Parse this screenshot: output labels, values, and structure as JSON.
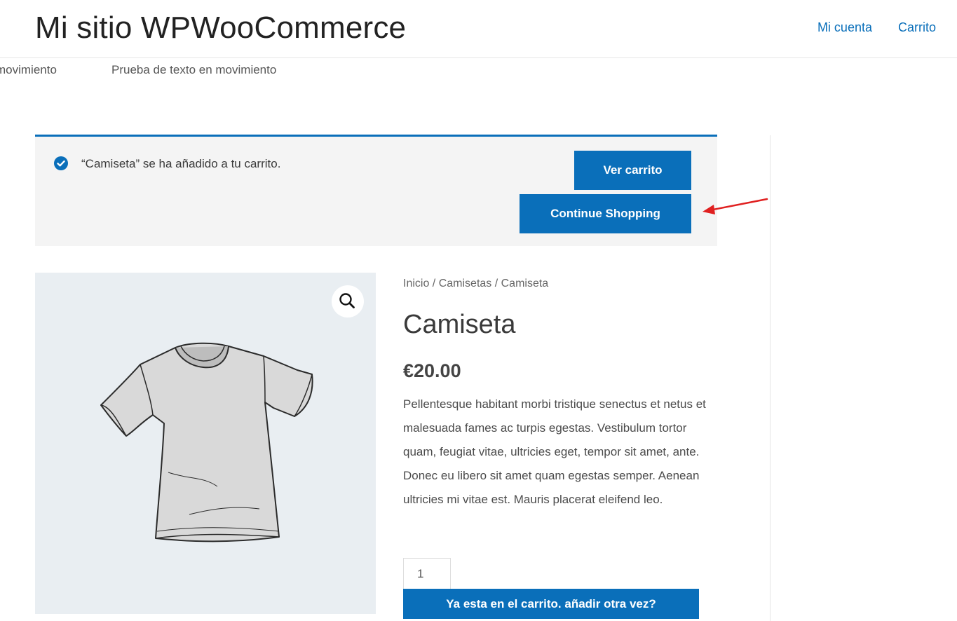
{
  "header": {
    "site_title": "Mi sitio WPWooCommerce",
    "nav": [
      "Mi cuenta",
      "Carrito"
    ]
  },
  "marquee": {
    "items": [
      "movimiento",
      "Prueba de texto en movimiento"
    ]
  },
  "notice": {
    "message": "“Camiseta” se ha añadido a tu carrito.",
    "view_cart_label": "Ver carrito",
    "continue_label": "Continue Shopping"
  },
  "product": {
    "breadcrumb": [
      "Inicio",
      "Camisetas",
      "Camiseta"
    ],
    "breadcrumb_separator": " / ",
    "title": "Camiseta",
    "price": "€20.00",
    "description": "Pellentesque habitant morbi tristique senectus et netus et malesuada fames ac turpis egestas. Vestibulum tortor quam, feugiat vitae, ultricies eget, tempor sit amet, ante. Donec eu libero sit amet quam egestas semper. Aenean ultricies mi vitae est. Mauris placerat eleifend leo.",
    "quantity": "1",
    "add_to_cart_label": "Ya esta en el carrito. añadir otra vez?"
  },
  "colors": {
    "accent": "#0a6fba",
    "annotation_arrow": "#e02020"
  },
  "icons": [
    "check-circle-icon",
    "search-icon",
    "arrow-annotation-icon"
  ]
}
